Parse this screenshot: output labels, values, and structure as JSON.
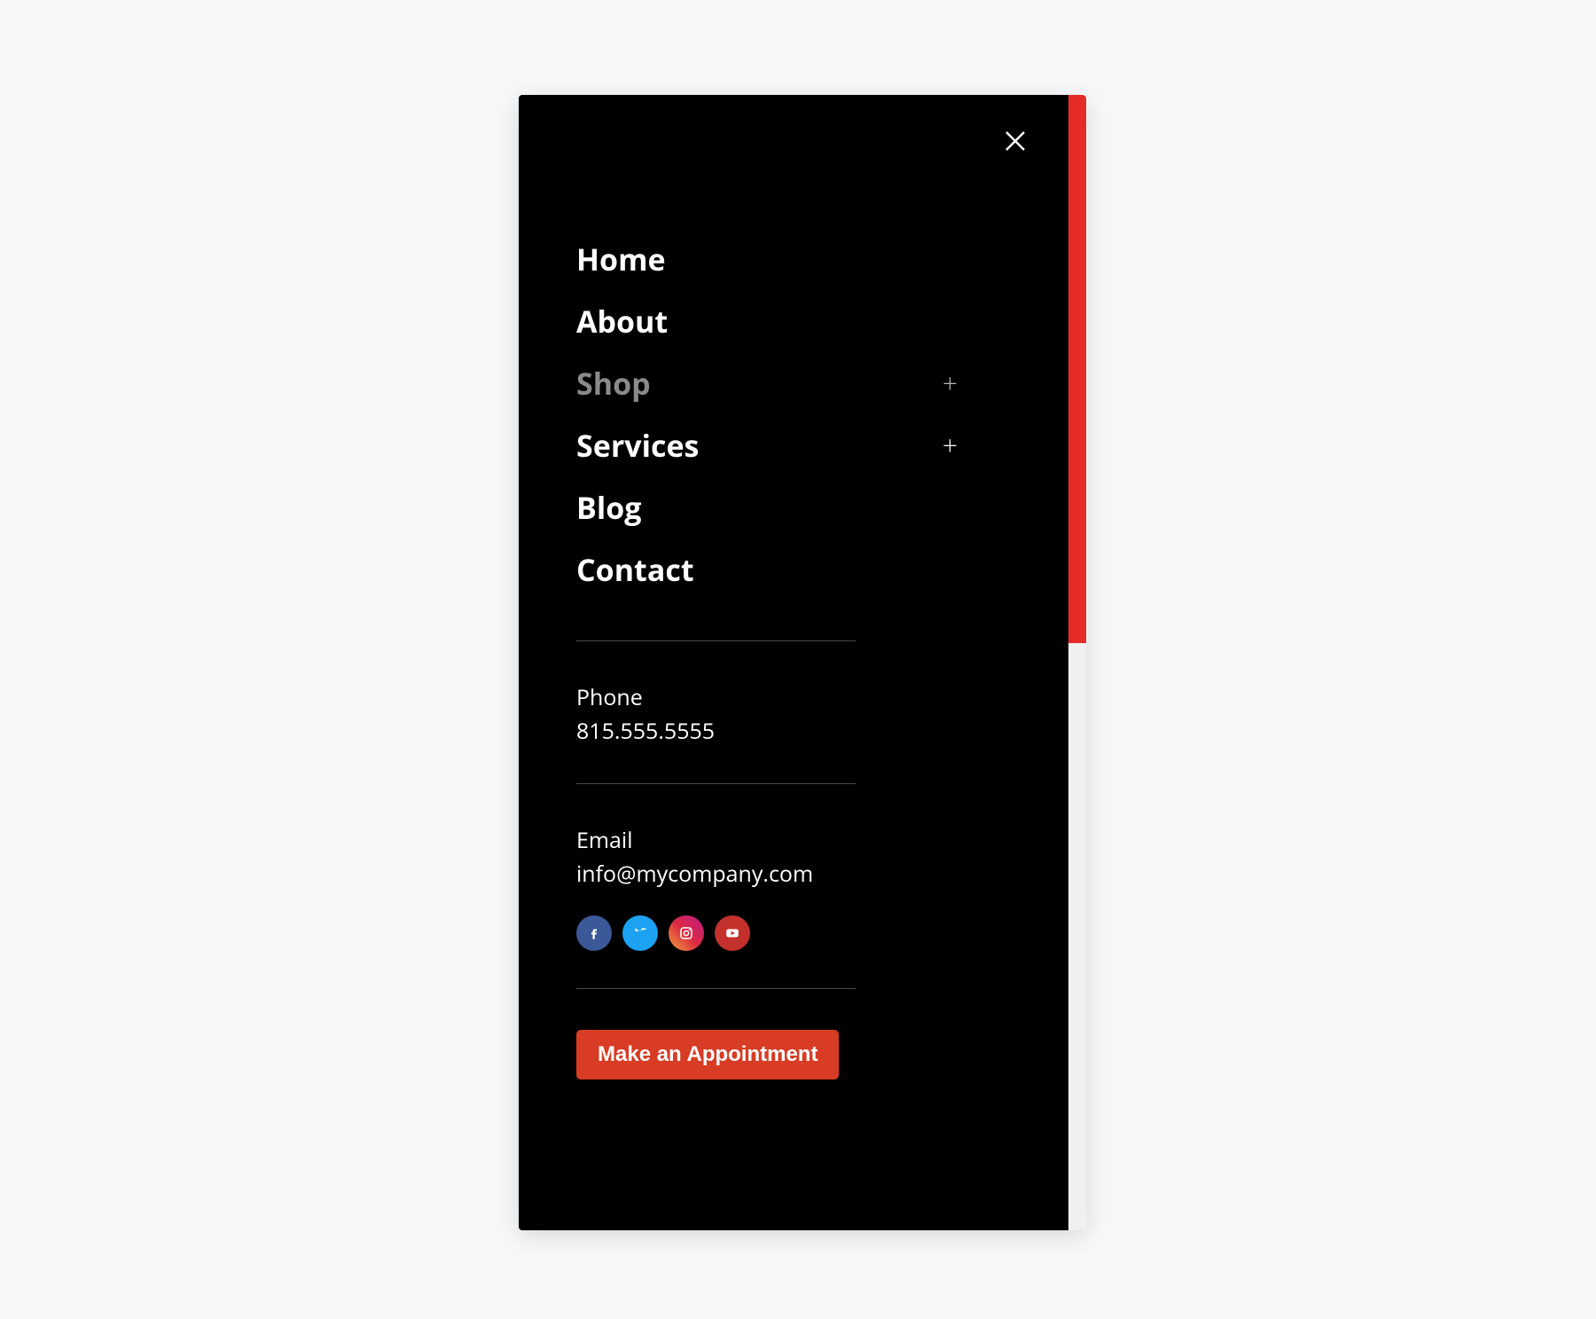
{
  "nav": {
    "items": [
      {
        "label": "Home"
      },
      {
        "label": "About"
      },
      {
        "label": "Shop"
      },
      {
        "label": "Services"
      },
      {
        "label": "Blog"
      },
      {
        "label": "Contact"
      }
    ]
  },
  "contact": {
    "phone_label": "Phone",
    "phone_value": "815.555.5555",
    "email_label": "Email",
    "email_value": "info@mycompany.com"
  },
  "socials": {
    "facebook": "facebook",
    "twitter": "twitter",
    "instagram": "instagram",
    "youtube": "youtube"
  },
  "cta": {
    "label": "Make an Appointment"
  },
  "colors": {
    "accent": "#d83c24",
    "scrollbar": "#e42b26"
  }
}
